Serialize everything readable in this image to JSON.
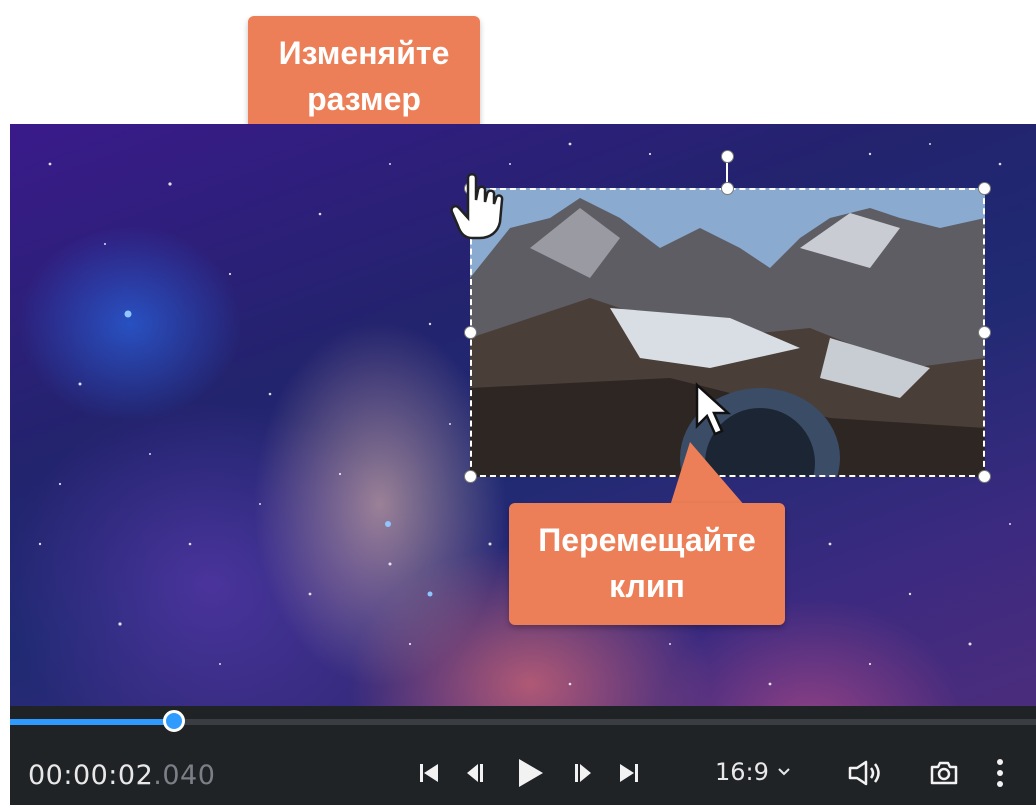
{
  "callouts": {
    "resize_line1": "Изменяйте",
    "resize_line2": "размер",
    "move_line1": "Перемещайте",
    "move_line2": "клип"
  },
  "player": {
    "timecode_main": "00:00:02",
    "timecode_ms": ".040",
    "progress": 0.16,
    "aspect_ratio": "16:9",
    "accent_color": "#2f9bff",
    "callout_color": "#ec7f57"
  },
  "icons": {
    "skip_start": "skip-to-start-icon",
    "prev_frame": "previous-frame-icon",
    "play": "play-icon",
    "next_frame": "next-frame-icon",
    "skip_end": "skip-to-end-icon",
    "volume": "volume-icon",
    "snapshot": "camera-icon",
    "more": "more-vertical-icon"
  }
}
